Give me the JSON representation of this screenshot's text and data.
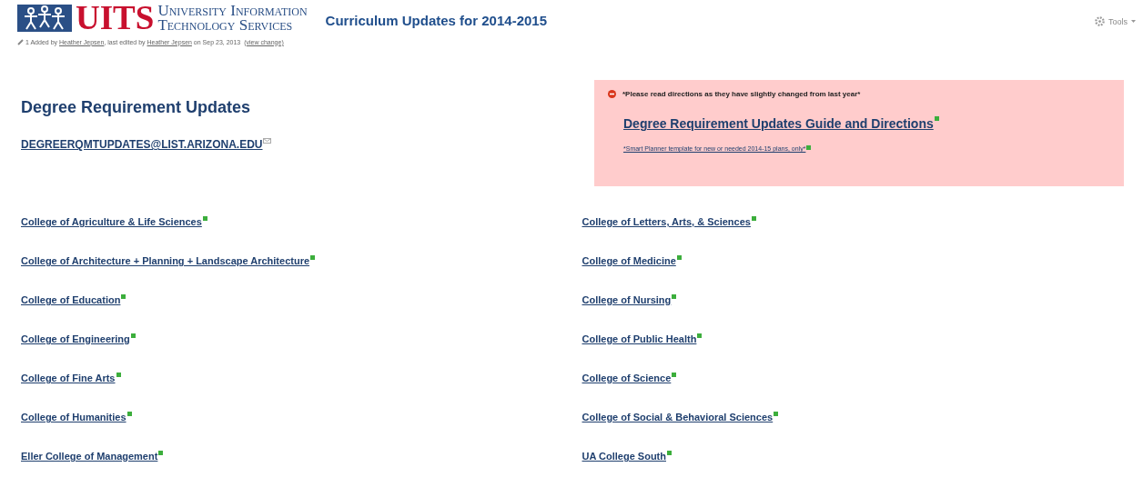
{
  "header": {
    "logo": {
      "acronym": "UITS",
      "name_line_1": "University Information",
      "name_line_2": "Technology Services"
    },
    "page_title": "Curriculum Updates for 2014-2015",
    "tools_menu": "Tools"
  },
  "meta": {
    "attachments": "1",
    "added_by_prefix": "Added by",
    "author": "Heather Jepsen",
    "edited_by_prefix": ", last edited by",
    "editor": "Heather Jepsen",
    "date_text": "on Sep 23, 2013",
    "view_change": "(view change)"
  },
  "left_panel": {
    "heading": "Degree Requirement Updates",
    "email": "DEGREERQMTUPDATES@LIST.ARIZONA.EDU"
  },
  "notice": {
    "warning": "*Please read directions as they have slightly changed from last year*",
    "guide_link": "Degree Requirement Updates Guide and Directions",
    "template_link": "*Smart Planner template for new or needed 2014-15 plans, only*"
  },
  "colleges_left": [
    "College of Agriculture & Life Sciences",
    "College of Architecture + Planning + Landscape Architecture",
    "College of Education",
    "College of Engineering",
    "College of Fine Arts",
    "College of Humanities",
    "Eller College of Management"
  ],
  "colleges_right": [
    "College of Letters, Arts, & Sciences",
    "College of Medicine",
    "College of Nursing",
    "College of Public Health",
    "College of Science",
    "College of Social & Behavioral Sciences",
    "UA College South"
  ]
}
